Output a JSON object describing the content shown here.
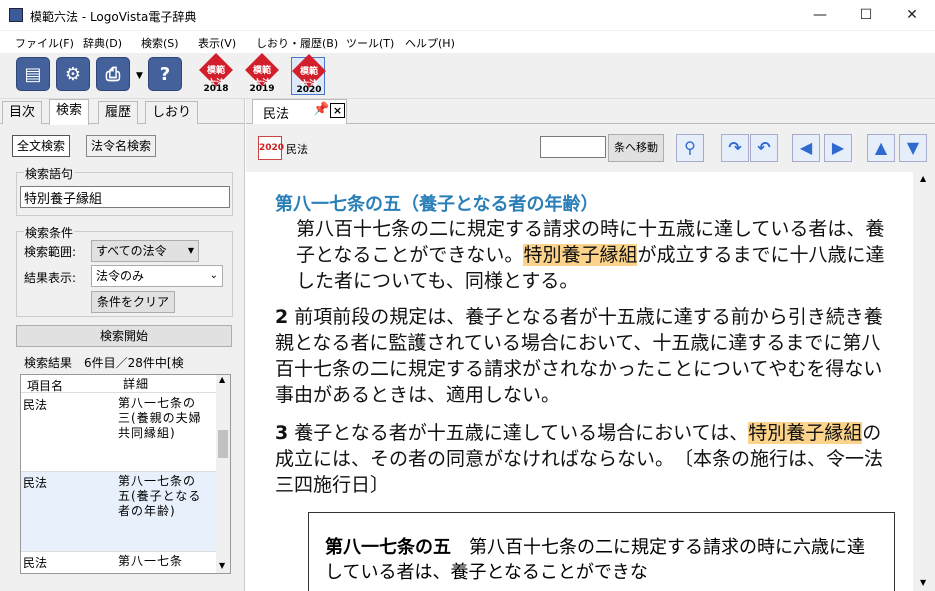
{
  "window": {
    "title": "模範六法 - LogoVista電子辞典"
  },
  "menu": [
    "ファイル(F)",
    "辞典(D)",
    "検索(S)",
    "表示(V)",
    "しおり・履歴(B)",
    "ツール(T)",
    "ヘルプ(H)"
  ],
  "toolbar": {
    "dicts": [
      {
        "label": "模範\n六法",
        "year": "2018"
      },
      {
        "label": "模範\n六法",
        "year": "2019"
      },
      {
        "label": "模範\n六法",
        "year": "2020"
      }
    ]
  },
  "left_tabs": [
    "目次",
    "検索",
    "履歴",
    "しおり"
  ],
  "search_tabs": [
    "全文検索",
    "法令名検索"
  ],
  "search": {
    "query_title": "検索語句",
    "query_value": "特別養子縁組",
    "conditions_title": "検索条件",
    "range_label": "検索範囲:",
    "range_value": "すべての法令",
    "display_label": "結果表示:",
    "display_value": "法令のみ",
    "clear_button": "条件をクリア",
    "start_button": "検索開始",
    "results_label": "検索結果　6件目／28件中[検",
    "col_name": "項目名",
    "col_detail": "詳細",
    "rows": [
      {
        "name": "民法",
        "detail": "第八一七条の三(養親の夫婦共同縁組)"
      },
      {
        "name": "民法",
        "detail": "第八一七条の五(養子となる者の年齢)"
      },
      {
        "name": "民法",
        "detail": "第八一七条"
      }
    ]
  },
  "right_tab": {
    "label": "民法",
    "close": "×"
  },
  "doc_toolbar": {
    "dict_badge": "2020",
    "dict_name": "民法",
    "goto_input": "",
    "goto_button": "条へ移動"
  },
  "article": {
    "title": "第八一七条の五（養子となる者の年齢）",
    "p1_pre": "第八百十七条の二に規定する請求の時に十五歳に達している者は、養子となることができない。",
    "p1_hl": "特別養子縁組",
    "p1_post": "が成立するまでに十八歳に達した者についても、同様とする。",
    "p2_num": "2",
    "p2_text": "前項前段の規定は、養子となる者が十五歳に達する前から引き続き養親となる者に監護されている場合において、十五歳に達するまでに第八百十七条の二に規定する請求がされなかったことについてやむを得ない事由があるときは、適用しない。",
    "p3_num": "3",
    "p3_pre": "養子となる者が十五歳に達している場合においては、",
    "p3_hl": "特別養子縁組",
    "p3_post": "の成立には、その者の同意がなければならない。　〔本条の施行は、令一法三四施行日〕",
    "box_title": "第八一七条の五",
    "box_text": "第八百十七条の二に規定する請求の時に六歳に達している者は、養子となることができな"
  }
}
